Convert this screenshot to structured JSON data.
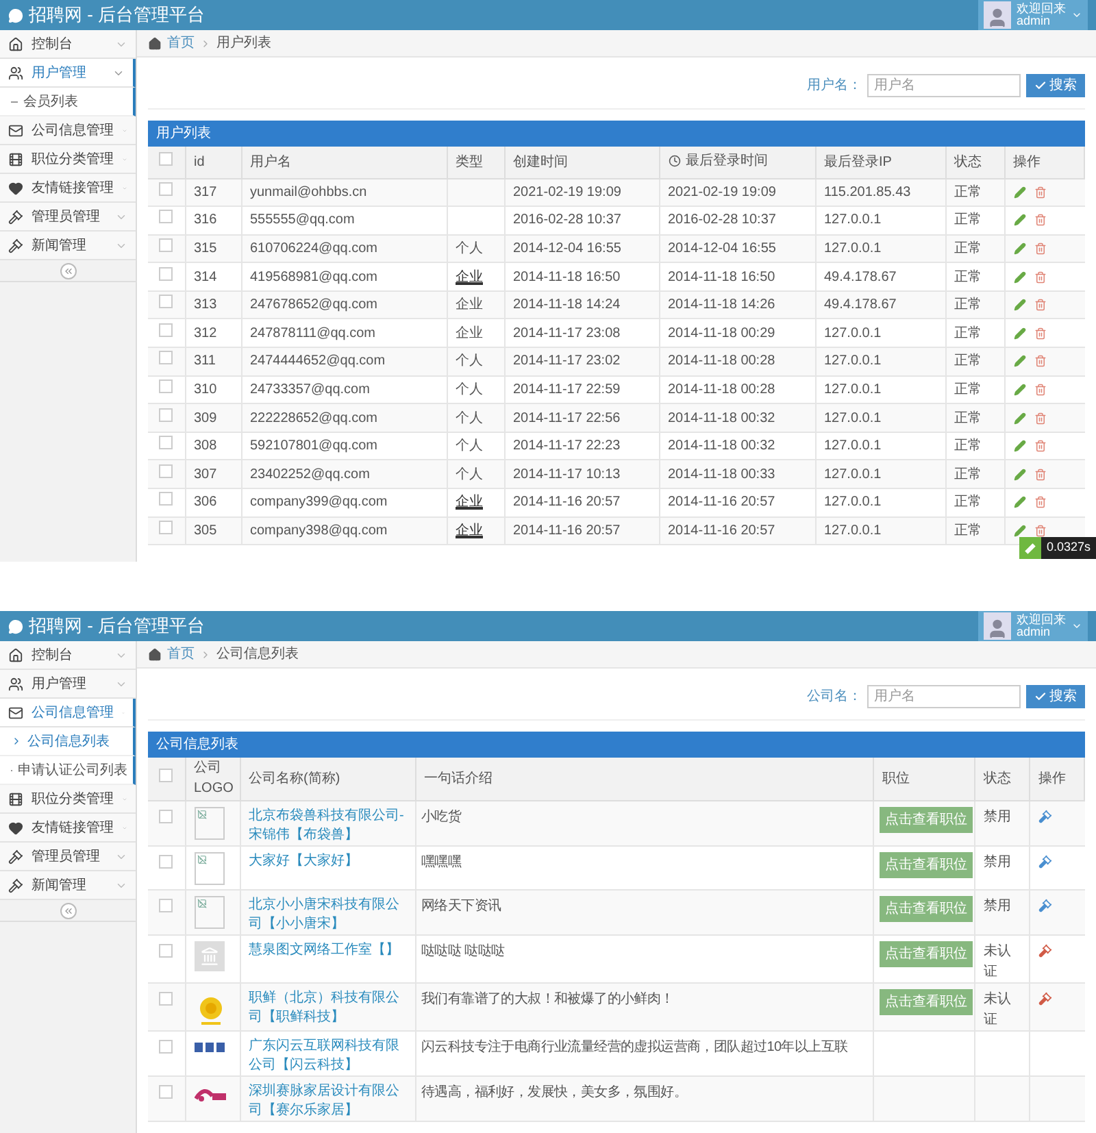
{
  "screens": [
    {
      "header": {
        "title": "招聘网 - 后台管理平台",
        "greeting": "欢迎回来",
        "user": "admin"
      },
      "sidebar": {
        "items": [
          {
            "label": "控制台",
            "selected": false,
            "expanded": false
          },
          {
            "label": "用户管理",
            "selected": true,
            "expanded": true,
            "children": [
              {
                "label": "会员列表",
                "selected": false
              }
            ]
          },
          {
            "label": "公司信息管理",
            "selected": false,
            "expanded": false
          },
          {
            "label": "职位分类管理",
            "selected": false,
            "expanded": false
          },
          {
            "label": "友情链接管理",
            "selected": false,
            "expanded": false
          },
          {
            "label": "管理员管理",
            "selected": false,
            "expanded": false
          },
          {
            "label": "新闻管理",
            "selected": false,
            "expanded": false
          }
        ]
      },
      "breadcrumb": [
        "首页",
        "用户列表"
      ],
      "search": {
        "label": "用户名：",
        "placeholder": "用户名",
        "button": "搜索"
      },
      "table": {
        "kind": "users",
        "title": "用户列表",
        "all_checked": false,
        "columns": [
          "id",
          "用户名",
          "类型",
          "创建时间",
          "最后登录时间",
          "最后登录IP",
          "状态",
          "操作"
        ],
        "rows": [
          {
            "checked": false,
            "id": "317",
            "user": "yunmail@ohbbs.cn",
            "type": "",
            "created": "2021-02-19 19:09",
            "last_login": "2021-02-19 19:09",
            "ip": "115.201.85.43",
            "status": "正常"
          },
          {
            "checked": false,
            "id": "316",
            "user": "555555@qq.com",
            "type": "",
            "created": "2016-02-28 10:37",
            "last_login": "2016-02-28 10:37",
            "ip": "127.0.0.1",
            "status": "正常"
          },
          {
            "checked": false,
            "id": "315",
            "user": "610706224@qq.com",
            "type": "个人",
            "type_link": false,
            "created": "2014-12-04 16:55",
            "last_login": "2014-12-04 16:55",
            "ip": "127.0.0.1",
            "status": "正常"
          },
          {
            "checked": false,
            "id": "314",
            "user": "419568981@qq.com",
            "type": "企业",
            "type_link": true,
            "created": "2014-11-18 16:50",
            "last_login": "2014-11-18 16:50",
            "ip": "49.4.178.67",
            "status": "正常"
          },
          {
            "checked": false,
            "id": "313",
            "user": "247678652@qq.com",
            "type": "企业",
            "type_link": false,
            "created": "2014-11-18 14:24",
            "last_login": "2014-11-18 14:26",
            "ip": "49.4.178.67",
            "status": "正常"
          },
          {
            "checked": false,
            "id": "312",
            "user": "247878111@qq.com",
            "type": "企业",
            "type_link": false,
            "created": "2014-11-17 23:08",
            "last_login": "2014-11-18 00:29",
            "ip": "127.0.0.1",
            "status": "正常"
          },
          {
            "checked": false,
            "id": "311",
            "user": "2474444652@qq.com",
            "type": "个人",
            "type_link": false,
            "created": "2014-11-17 23:02",
            "last_login": "2014-11-18 00:28",
            "ip": "127.0.0.1",
            "status": "正常"
          },
          {
            "checked": false,
            "id": "310",
            "user": "24733357@qq.com",
            "type": "个人",
            "type_link": false,
            "created": "2014-11-17 22:59",
            "last_login": "2014-11-18 00:28",
            "ip": "127.0.0.1",
            "status": "正常"
          },
          {
            "checked": false,
            "id": "309",
            "user": "222228652@qq.com",
            "type": "个人",
            "type_link": false,
            "created": "2014-11-17 22:56",
            "last_login": "2014-11-18 00:32",
            "ip": "127.0.0.1",
            "status": "正常"
          },
          {
            "checked": false,
            "id": "308",
            "user": "592107801@qq.com",
            "type": "个人",
            "type_link": false,
            "created": "2014-11-17 22:23",
            "last_login": "2014-11-18 00:32",
            "ip": "127.0.0.1",
            "status": "正常"
          },
          {
            "checked": false,
            "id": "307",
            "user": "23402252@qq.com",
            "type": "个人",
            "type_link": false,
            "created": "2014-11-17 10:13",
            "last_login": "2014-11-18 00:33",
            "ip": "127.0.0.1",
            "status": "正常"
          },
          {
            "checked": false,
            "id": "306",
            "user": "company399@qq.com",
            "type": "企业",
            "type_link": true,
            "created": "2014-11-16 20:57",
            "last_login": "2014-11-16 20:57",
            "ip": "127.0.0.1",
            "status": "正常"
          },
          {
            "checked": false,
            "id": "305",
            "user": "company398@qq.com",
            "type": "企业",
            "type_link": true,
            "created": "2014-11-16 20:57",
            "last_login": "2014-11-16 20:57",
            "ip": "127.0.0.1",
            "status": "正常"
          }
        ]
      },
      "timer_badge": "0.0327s"
    },
    {
      "header": {
        "title": "招聘网 - 后台管理平台",
        "greeting": "欢迎回来",
        "user": "admin"
      },
      "sidebar": {
        "items": [
          {
            "label": "控制台",
            "selected": false,
            "expanded": false
          },
          {
            "label": "用户管理",
            "selected": false,
            "expanded": false
          },
          {
            "label": "公司信息管理",
            "selected": true,
            "expanded": true,
            "children": [
              {
                "label": "公司信息列表",
                "selected": true
              },
              {
                "label": "申请认证公司列表",
                "selected": false
              }
            ]
          },
          {
            "label": "职位分类管理",
            "selected": false,
            "expanded": false
          },
          {
            "label": "友情链接管理",
            "selected": false,
            "expanded": false
          },
          {
            "label": "管理员管理",
            "selected": false,
            "expanded": false
          },
          {
            "label": "新闻管理",
            "selected": false,
            "expanded": false
          }
        ]
      },
      "breadcrumb": [
        "首页",
        "公司信息列表"
      ],
      "search": {
        "label": "公司名：",
        "placeholder": "用户名",
        "button": "搜索"
      },
      "table": {
        "kind": "companies",
        "title": "公司信息列表",
        "all_checked": false,
        "columns": [
          "公司LOGO",
          "公司名称(简称)",
          "一句话介绍",
          "职位",
          "状态",
          "操作"
        ],
        "rows": [
          {
            "checked": false,
            "kind": "broken",
            "name": "北京布袋兽科技有限公司-宋锦伟【布袋兽】",
            "intro": "小吃货",
            "job_button": "点击查看职位",
            "status": "禁用",
            "color": "#4a8fd0"
          },
          {
            "checked": false,
            "kind": "broken",
            "name": "大家好【大家好】",
            "intro": "嘿嘿嘿",
            "job_button": "点击查看职位",
            "status": "禁用",
            "color": "#4a8fd0"
          },
          {
            "checked": false,
            "kind": "broken",
            "name": "北京小小唐宋科技有限公司【小小唐宋】",
            "intro": "网络天下资讯",
            "job_button": "点击查看职位",
            "status": "禁用",
            "color": "#4a8fd0"
          },
          {
            "checked": false,
            "kind": "building",
            "name": "慧泉图文网络工作室【】",
            "intro": "哒哒哒 哒哒哒",
            "job_button": "点击查看职位",
            "status": "未认证",
            "color": "#d15b47"
          },
          {
            "checked": false,
            "kind": "seal",
            "name": "职鲜（北京）科技有限公司【职鲜科技】",
            "intro": "我们有靠谱了的大叔！和被爆了的小鲜肉！",
            "job_button": "点击查看职位",
            "status": "未认证",
            "color": "#d15b47"
          },
          {
            "checked": false,
            "kind": "wordmark",
            "name": "广东闪云互联网科技有限公司【闪云科技】",
            "intro": "闪云科技专注于电商行业流量经营的虚拟运营商，团队超过10年以上互联"
          },
          {
            "checked": false,
            "kind": "swoosh",
            "name": "深圳赛脉家居设计有限公司【赛尔乐家居】",
            "intro": "待遇高，福利好，发展快，美女多，氛围好。"
          }
        ]
      }
    }
  ]
}
